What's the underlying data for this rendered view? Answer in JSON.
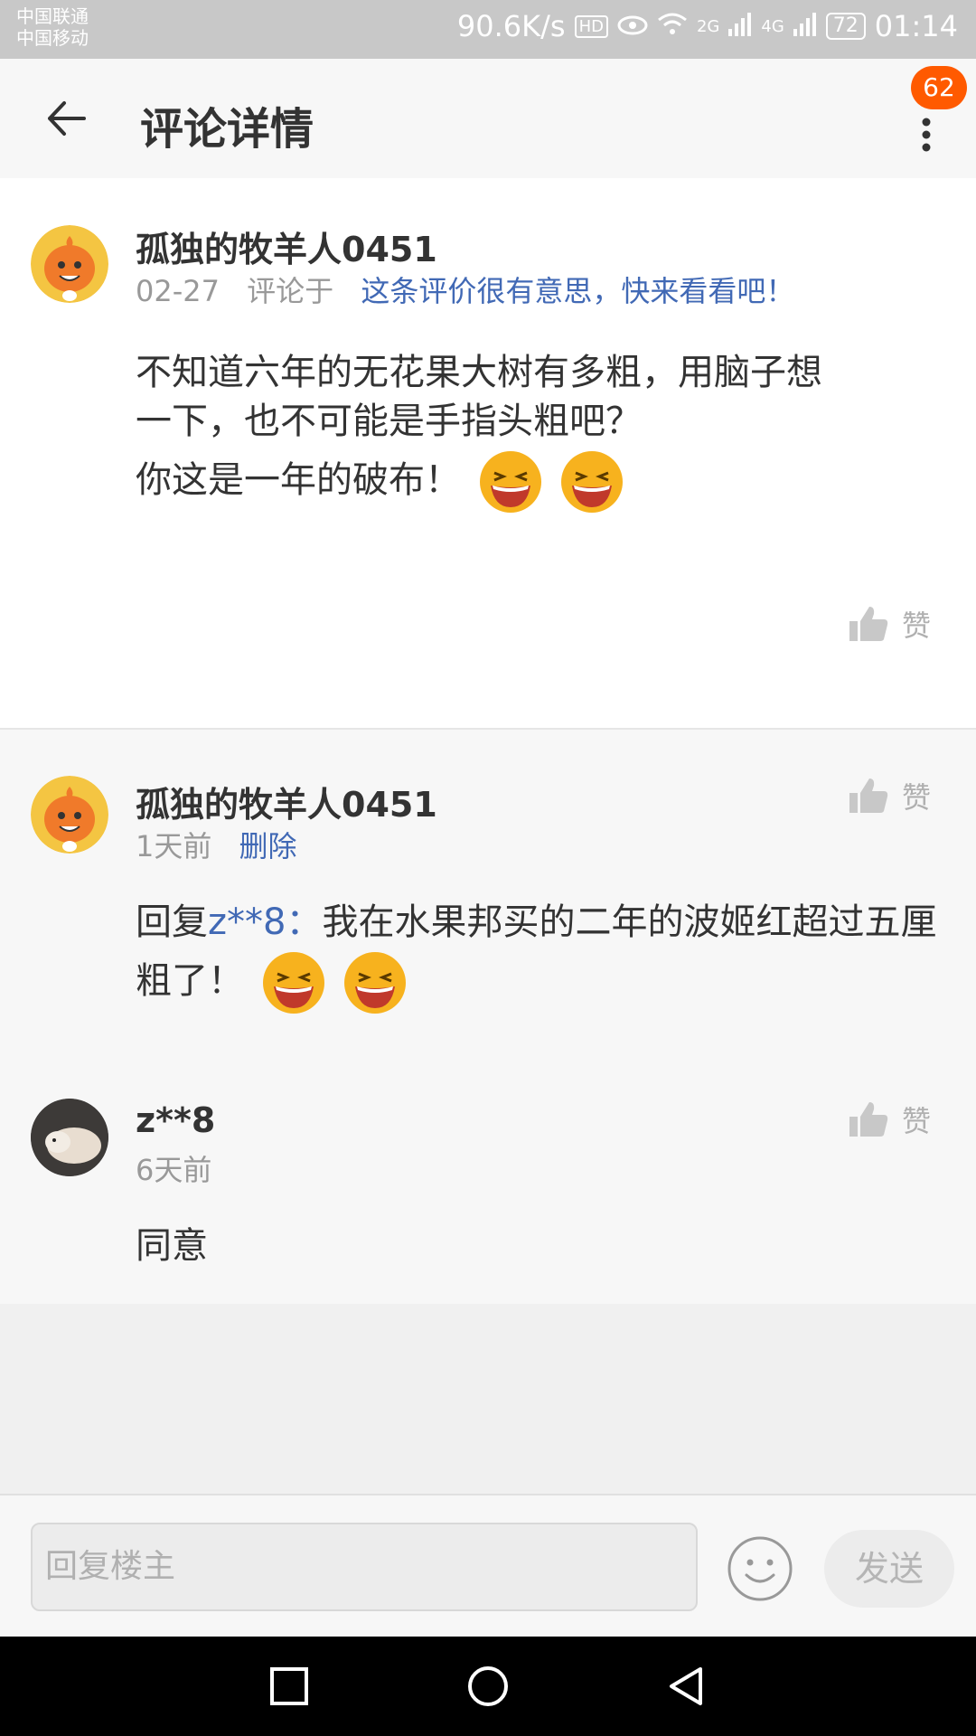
{
  "status_bar": {
    "carrier1": "中国联通",
    "carrier2": "中国移动",
    "speed": "90.6K/s",
    "hd": "HD",
    "net_2g": "2G",
    "net_4g": "4G",
    "battery": "72",
    "time": "01:14"
  },
  "header": {
    "title": "评论详情",
    "badge": "62"
  },
  "main_comment": {
    "username": "孤独的牧羊人0451",
    "date": "02-27",
    "commented_on_label": "评论于",
    "commented_on_link": "这条评价很有意思，快来看看吧！",
    "text_line1": "不知道六年的无花果大树有多粗，用脑子想",
    "text_line2": "一下，也不可能是手指头粗吧？",
    "text_line3": "你这是一年的破布！",
    "like_label": "赞"
  },
  "replies": [
    {
      "username": "孤独的牧羊人0451",
      "time": "1天前",
      "action": "删除",
      "reply_prefix": "回复",
      "reply_to": "z**8：",
      "text_line1": "我在水果邦买的二年的波姬红超过五厘",
      "text_line2": "粗了！",
      "like_label": "赞"
    },
    {
      "username": "z**8",
      "time": "6天前",
      "text": "同意",
      "like_label": "赞"
    }
  ],
  "reply_bar": {
    "placeholder": "回复楼主",
    "send_label": "发送"
  },
  "colors": {
    "accent_link": "#4169b5",
    "badge": "#ff5a00",
    "muted": "#999999"
  }
}
